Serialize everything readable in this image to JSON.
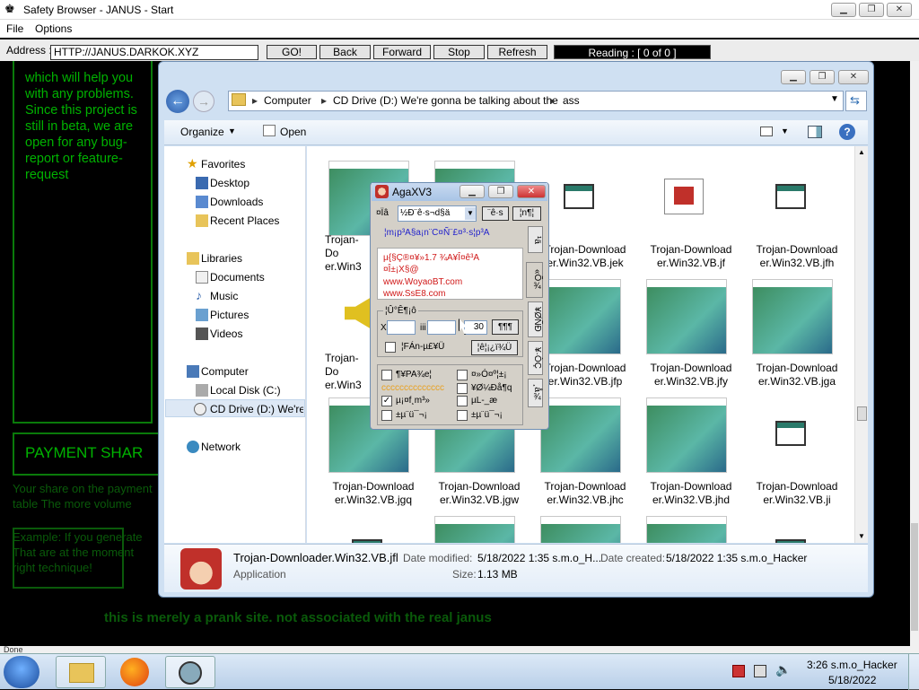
{
  "browser": {
    "title": "Safety Browser - JANUS - Start",
    "menu": [
      "File",
      "Options"
    ],
    "address_label": "Address :",
    "address_value": "HTTP://JANUS.DARKOK.XYZ",
    "buttons": [
      "GO!",
      "Back",
      "Forward",
      "Stop",
      "Refresh"
    ],
    "reading": "Reading : [ 0  of  0 ]",
    "status": "Done"
  },
  "page": {
    "left_text": "which will help you with any problems. Since this project is still in beta, we are open for any bug-report or feature-request",
    "payment_heading": "PAYMENT SHAR",
    "share_text": "Your share on the payment table The more volume",
    "example_text": "Example: If you generate That are at the moment right technique!",
    "footer_text": "this is merely a prank site. not associated with the real janus",
    "colors": {
      "green": "#00b200",
      "dark_green": "#0a5a0a"
    }
  },
  "explorer": {
    "breadcrumb": [
      "Computer",
      "CD Drive (D:) We're gonna be talking about the",
      "ass"
    ],
    "toolbar": {
      "organize": "Organize",
      "open": "Open"
    },
    "sidebar": {
      "favorites_header": "Favorites",
      "favorites": [
        "Desktop",
        "Downloads",
        "Recent Places"
      ],
      "libraries_header": "Libraries",
      "libraries": [
        "Documents",
        "Music",
        "Pictures",
        "Videos"
      ],
      "computer_header": "Computer",
      "drives": [
        "Local Disk (C:)",
        "CD Drive (D:) We're g"
      ],
      "network": "Network"
    },
    "files": [
      [
        "",
        "",
        "Trojan-Download er.Win32.VB.jek",
        "Trojan-Download er.Win32.VB.jf",
        "Trojan-Download er.Win32.VB.jfh"
      ],
      [
        "",
        "",
        "Trojan-Download er.Win32.VB.jfp",
        "Trojan-Download er.Win32.VB.jfy",
        "Trojan-Download er.Win32.VB.jga"
      ],
      [
        "Trojan-Download er.Win32.VB.jgq",
        "Trojan-Download er.Win32.VB.jgw",
        "Trojan-Download er.Win32.VB.jhc",
        "Trojan-Download er.Win32.VB.jhd",
        "Trojan-Download er.Win32.VB.ji"
      ]
    ],
    "partial_labels": [
      "Trojan-Do er.Win3",
      "Trojan-Do er.Win3"
    ],
    "details": {
      "name": "Trojan-Downloader.Win32.VB.jfl",
      "type": "Application",
      "modified_label": "Date modified:",
      "modified_value": "5/18/2022 1:35 s.m.o_H...",
      "created_label": "Date created:",
      "created_value": "5/18/2022 1:35 s.m.o_Hacker",
      "size_label": "Size:",
      "size_value": "1.13 MB"
    }
  },
  "dialog": {
    "title": "AgaXV3",
    "row1_label": "¤Ïâ",
    "row1_select": "½Ð¨ê·s¬d§ä",
    "row1_btn1": "¨ê·s",
    "row1_btn2": "¦n¶¦",
    "status_line": "¦m¡p³A§a¡n¨C¤Ñ¨£¤³·s¦p³A",
    "red_lines": [
      "µ{§Ç®¤¥»1.7 ¾A¥Î¤ê³A",
      "¤Î±¡X§@",
      "www.WoyaoBT.com",
      "www.SsE8.com"
    ],
    "group_label": "¦Û°Ê¶¡ô",
    "x_label": "X",
    "y_label": "iii",
    "val30": "30",
    "btn_a": "¶¶¶",
    "chk_label": "¦FÁn-µ£¥Ü",
    "btn_b": "¦ê¦¡¿ï¾Ü",
    "options": [
      "¶¥PA¾e¦",
      "¤»Ó¤º¦±¡",
      "cccccccccccccc",
      "¥Ø¼Ðå¶q",
      "µ¡¤f¸m³»",
      "µL-_æ",
      "±µ¨ü¯¬¡",
      "±µ¨ü¯¬¡"
    ],
    "tabs": [
      "¹ä",
      "«Õ¾",
      "¥ØÑÐ",
      "¥·ÒÇ",
      "¸å¾"
    ]
  },
  "taskbar": {
    "clock_user": "3:26 s.m.o_Hacker",
    "clock_date": "5/18/2022"
  }
}
